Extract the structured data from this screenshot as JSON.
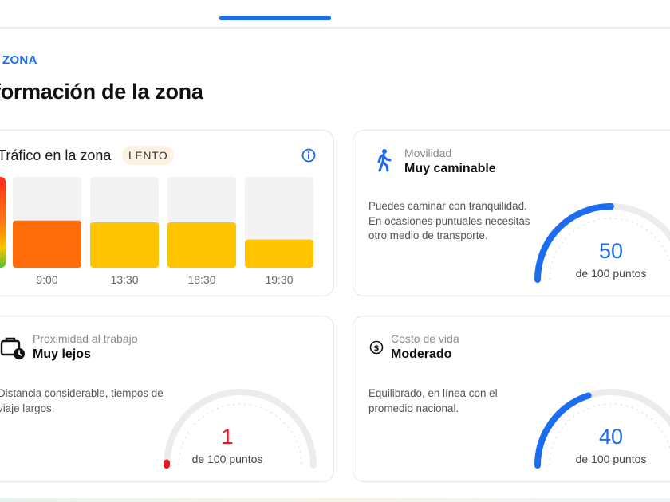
{
  "section": {
    "kicker": "ZONA",
    "title": "formación de la zona"
  },
  "traffic": {
    "title": "Tráfico en la zona",
    "badge": "LENTO",
    "info_icon": "info-circle-icon",
    "chart_data": {
      "type": "bar",
      "categories": [
        "9:00",
        "13:30",
        "18:30",
        "19:30"
      ],
      "values": [
        52,
        50,
        50,
        31
      ],
      "ylim": [
        0,
        100
      ],
      "colors": [
        "#ff6d0a",
        "#ffc400",
        "#ffc400",
        "#ffc400"
      ],
      "track_color": "#f3f3f3"
    }
  },
  "mobility": {
    "icon": "pedestrian-walking-icon",
    "subtitle": "Movilidad",
    "value": "Muy caminable",
    "description": "Puedes caminar con tranquilidad. En ocasiones puntuales necesitas otro medio de transporte.",
    "score": "50",
    "score_fraction": 0.5,
    "caption": "de 100 puntos",
    "color": "#1a6cf0"
  },
  "work": {
    "icon": "briefcase-clock-icon",
    "subtitle": "Proximidad al trabajo",
    "value": "Muy lejos",
    "description": "Distancia considerable, tiempos de viaje largos.",
    "score": "1",
    "score_fraction": 0.01,
    "caption": "de 100 puntos",
    "color": "#f0141e"
  },
  "cost": {
    "icon": "dollar-coin-icon",
    "subtitle": "Costo de vida",
    "value": "Moderado",
    "description": "Equilibrado, en línea con el promedio nacional.",
    "score": "40",
    "score_fraction": 0.4,
    "caption": "de 100 puntos",
    "color": "#1a6cf0"
  }
}
